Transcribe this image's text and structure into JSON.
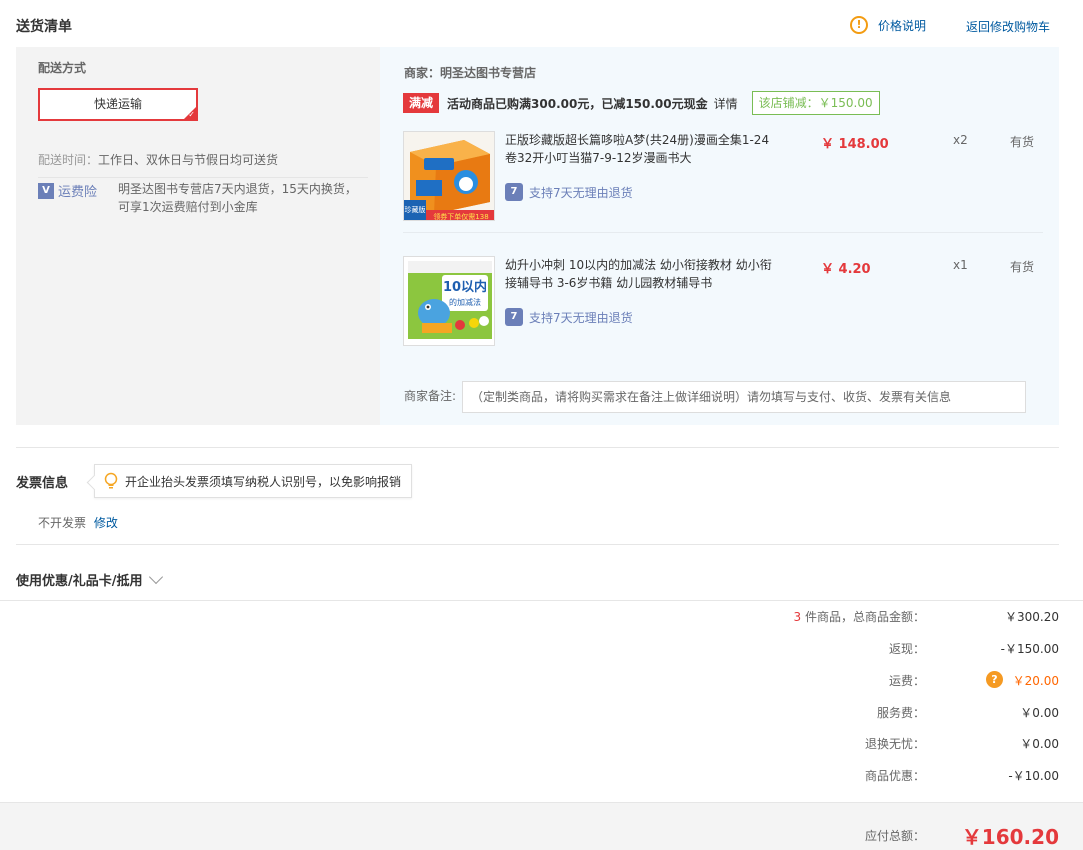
{
  "header": {
    "title": "送货清单",
    "price_help": "价格说明",
    "back_to_cart": "返回修改购物车"
  },
  "shipping": {
    "method_label": "配送方式",
    "method_selected": "快递运输",
    "time_label": "配送时间：",
    "time_value": "工作日、双休日与节假日均可送货",
    "insurance_label": "运费险",
    "insurance_desc": "明圣达图书专营店7天内退货，15天内换货，可享1次运费赔付到小金库"
  },
  "store": {
    "merchant": "商家：明圣达图书专营店",
    "promo_tag": "满减",
    "promo_text": "活动商品已购满300.00元，已减150.00元现金",
    "promo_detail": "详情",
    "shop_discount": "该店铺减：￥150.00"
  },
  "products": [
    {
      "name": "正版珍藏版超长篇哆啦A梦(共24册)漫画全集1-24卷32开小叮当猫7-9-12岁漫画书大",
      "price": "￥ 148.00",
      "qty": "x2",
      "stock": "有货",
      "return_policy": "支持7天无理由退货",
      "image_badge": "珍藏版",
      "image_banner": "领券下单仅需138"
    },
    {
      "name": "幼升小冲刺 10以内的加减法 幼小衔接教材 幼小衔接辅导书 3-6岁书籍 幼儿园教材辅导书",
      "price": "￥ 4.20",
      "qty": "x1",
      "stock": "有货",
      "return_policy": "支持7天无理由退货",
      "image_title_1": "10以内",
      "image_title_2": "的加减法"
    }
  ],
  "remark": {
    "label": "商家备注:",
    "placeholder": "（定制类商品，请将购买需求在备注上做详细说明）请勿填写与支付、收货、发票有关信息"
  },
  "invoice": {
    "title": "发票信息",
    "tip": "开企业抬头发票须填写纳税人识别号，以免影响报销",
    "status": "不开发票",
    "edit": "修改"
  },
  "coupon": {
    "label": "使用优惠/礼品卡/抵用"
  },
  "summary": {
    "count": "3",
    "count_suffix": "件商品，总商品金额：",
    "total_goods": "￥300.20",
    "cashback_label": "返现：",
    "cashback": "-￥150.00",
    "shipping_label": "运费：",
    "shipping_fee": "￥20.00",
    "service_label": "服务费：",
    "service_fee": "￥0.00",
    "worry_free_label": "退换无忧：",
    "worry_free": "￥0.00",
    "discount_label": "商品优惠：",
    "discount": "-￥10.00",
    "payable_label": "应付总额：",
    "payable": "￥160.20"
  },
  "colors": {
    "accent_red": "#e4393c",
    "link_blue": "#005aa0",
    "green": "#7abd54",
    "orange": "#ff6600"
  }
}
